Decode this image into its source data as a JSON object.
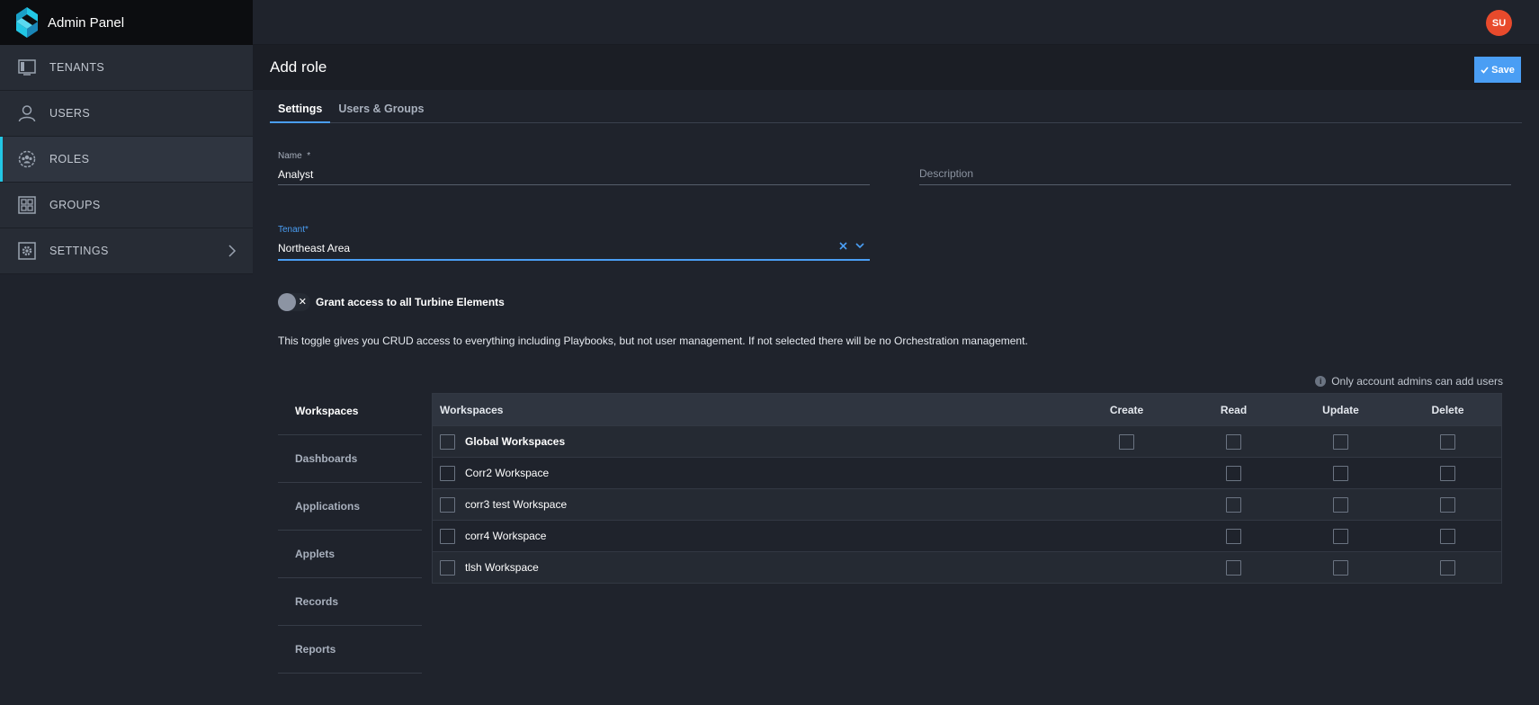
{
  "app": {
    "title": "Admin Panel"
  },
  "sidebar": {
    "items": [
      {
        "label": "TENANTS",
        "icon": "tenants-icon",
        "active": false
      },
      {
        "label": "USERS",
        "icon": "user-icon",
        "active": false
      },
      {
        "label": "ROLES",
        "icon": "roles-icon",
        "active": true
      },
      {
        "label": "GROUPS",
        "icon": "groups-icon",
        "active": false
      },
      {
        "label": "SETTINGS",
        "icon": "gear-icon",
        "active": false
      }
    ]
  },
  "user": {
    "initials": "SU"
  },
  "page": {
    "title": "Add role",
    "save_label": "Save"
  },
  "tabs": [
    {
      "label": "Settings",
      "active": true
    },
    {
      "label": "Users & Groups",
      "active": false
    }
  ],
  "form": {
    "name_label": "Name",
    "name_required": "*",
    "name_value": "Analyst",
    "description_placeholder": "Description",
    "tenant_label": "Tenant*",
    "tenant_value": "Northeast Area"
  },
  "toggle": {
    "label": "Grant access to all Turbine Elements",
    "help": "This toggle gives you CRUD access to everything including Playbooks, but not user management. If not selected there will be no Orchestration management."
  },
  "side_tabs": [
    "Workspaces",
    "Dashboards",
    "Applications",
    "Applets",
    "Records",
    "Reports"
  ],
  "admin_note": "Only account admins can add users",
  "table": {
    "headers": [
      "Workspaces",
      "Create",
      "Read",
      "Update",
      "Delete"
    ],
    "rows": [
      {
        "name": "Global Workspaces",
        "bold": true,
        "create": true
      },
      {
        "name": "Corr2 Workspace",
        "bold": false,
        "create": false
      },
      {
        "name": "corr3 test Workspace",
        "bold": false,
        "create": false
      },
      {
        "name": "corr4 Workspace",
        "bold": false,
        "create": false
      },
      {
        "name": "tlsh Workspace",
        "bold": false,
        "create": false
      }
    ]
  },
  "colors": {
    "accent": "#4a9ef4",
    "sidebar_active": "#22c7e5",
    "avatar": "#e84a2c"
  }
}
